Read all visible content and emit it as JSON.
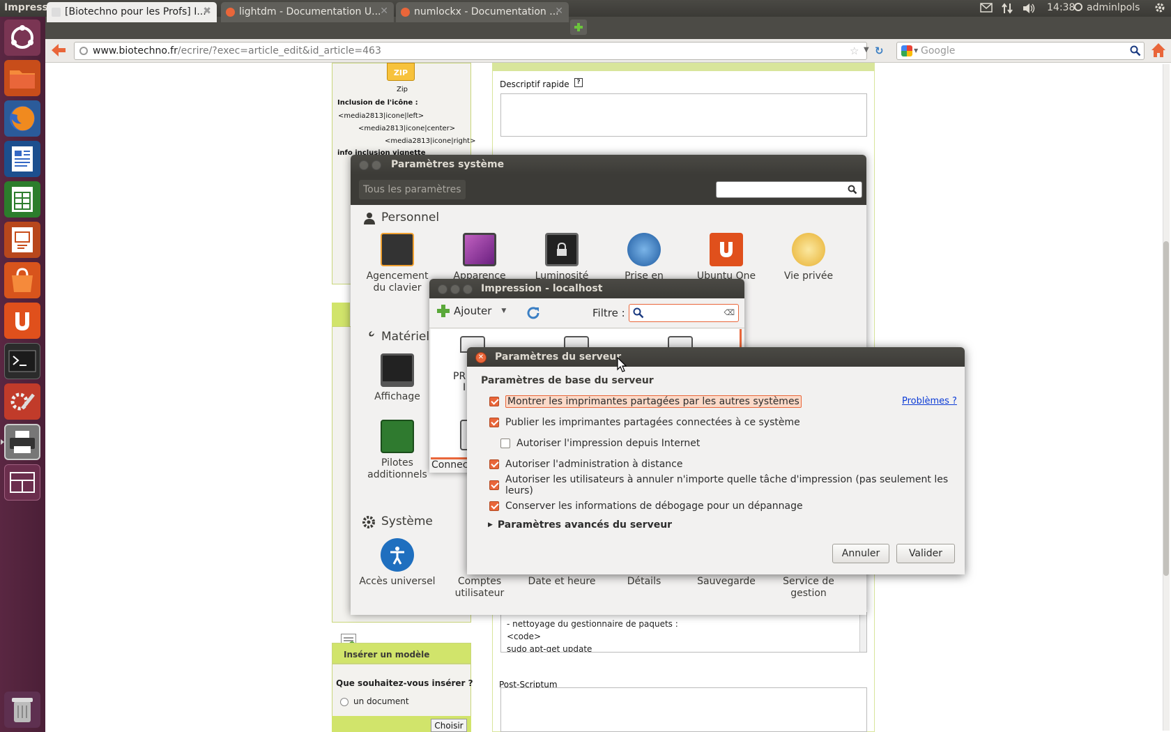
{
  "panel": {
    "app_title": "Impression",
    "time": "14:38",
    "user": "adminlpols"
  },
  "tabs": [
    {
      "label": "[Biotechno pour les Profs] I..."
    },
    {
      "label": "lightdm - Documentation U..."
    },
    {
      "label": "numlockx - Documentation ..."
    }
  ],
  "nav": {
    "url_host": "www.biotechno.fr",
    "url_path": "/ecrire/?exec=article_edit&id_article=463",
    "search_placeholder": "Google"
  },
  "page": {
    "zip_label": "Zip",
    "icon_inclusion_title": "Inclusion de l'icône :",
    "icon_left": "<media2813|icone|left>",
    "icon_center": "<media2813|icone|center>",
    "icon_right": "<media2813|icone|right>",
    "thumb_inclusion_title": "info inclusion vignette",
    "descriptif_label": "Descriptif rapide",
    "help_mark": "?",
    "code_line1": "- nettoyage du gestionnaire de paquets :",
    "code_line2": "<code>",
    "code_line3": "sudo apt-get update",
    "postscriptum_label": "Post-Scriptum",
    "template_title": "Insérer un modèle",
    "template_question": "Que souhaitez-vous insérer ?",
    "template_option": "un document",
    "choose_button": "Choisir"
  },
  "system_settings": {
    "title": "Paramètres système",
    "all_settings": "Tous les paramètres",
    "personal": {
      "heading": "Personnel",
      "items": [
        "Agencement du clavier",
        "Apparence",
        "Luminosité",
        "Prise en",
        "Ubuntu One",
        "Vie privée"
      ]
    },
    "hardware": {
      "heading": "Matériel",
      "items": [
        "Affichage",
        "Pilotes additionnels"
      ]
    },
    "system": {
      "heading": "Système",
      "items": [
        "Accès universel",
        "Comptes utilisateur",
        "Date et heure",
        "Détails",
        "Sauvegarde",
        "Service de gestion"
      ]
    }
  },
  "printing": {
    "title": "Impression - localhost",
    "add_button": "Ajouter",
    "filter_label": "Filtre :",
    "printer_partial": "PR",
    "printer_partial2": "I",
    "status_partial": "Connect"
  },
  "server_dialog": {
    "title": "Paramètres du serveur",
    "section": "Paramètres de base du serveur",
    "problems_link": "Problèmes ?",
    "options": [
      {
        "label": "Montrer les imprimantes partagées par les autres systèmes",
        "checked": true
      },
      {
        "label": "Publier les imprimantes partagées connectées à ce système",
        "checked": true
      },
      {
        "label": "Autoriser l'impression depuis Internet",
        "checked": false
      },
      {
        "label": "Autoriser l'administration à distance",
        "checked": true
      },
      {
        "label": "Autoriser les utilisateurs à annuler n'importe quelle tâche d'impression (pas seulement les leurs)",
        "checked": true
      },
      {
        "label": "Conserver les informations de débogage pour un dépannage",
        "checked": true
      }
    ],
    "advanced": "Paramètres avancés du serveur",
    "cancel": "Annuler",
    "ok": "Valider"
  },
  "colors": {
    "accent": "#e9663a",
    "launcher": "#4b1f37",
    "panel": "#3c3b37",
    "spip_green": "#d1e46b"
  }
}
